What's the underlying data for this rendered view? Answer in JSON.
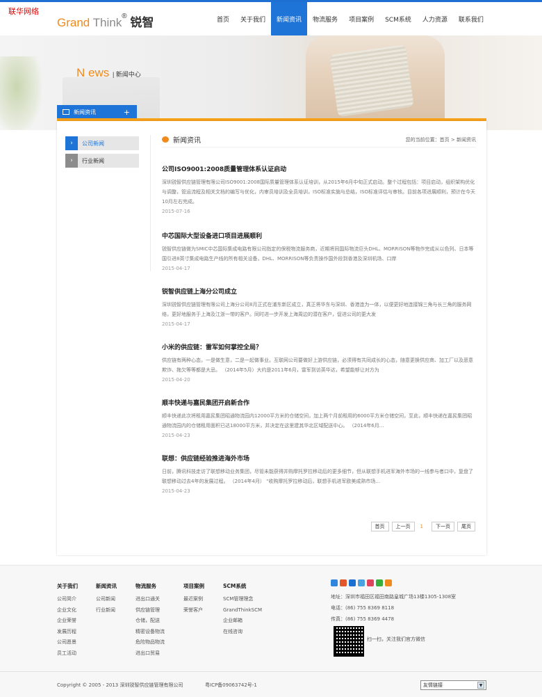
{
  "corner_label": "联华网络",
  "logo": {
    "grand": "Grand",
    "think": " Think",
    "reg": "®",
    "cn": " 锐智"
  },
  "nav": [
    "首页",
    "关于我们",
    "新闻资讯",
    "物流服务",
    "项目案例",
    "SCM系统",
    "人力资源",
    "联系我们"
  ],
  "nav_active": "新闻资讯",
  "banner": {
    "title": "N ews",
    "subtitle": "| 新闻中心",
    "tab_label": "新闻资讯",
    "tab_plus": "+"
  },
  "sidebar": [
    {
      "label": "公司新闻",
      "active": true
    },
    {
      "label": "行业新闻",
      "active": false
    }
  ],
  "section": {
    "title": "新闻资讯",
    "crumb": "您的当前位置：首页  >  新闻资讯"
  },
  "articles": [
    {
      "title": "公司ISO9001:2008质量管理体系认证启动",
      "body": "深圳锐智供应链管理有限公司ISO9001:2008国际质量管理体系认证培训，从2015年6月中旬正式启动。整个过程包括：项目启动，组织架构优化与调整，管运流程及相关文档的编写与优化，内审员培训及全员培训，ISO标准实施与总结，ISO标准评估与审核。目前各项进展顺利，预计在今天10月左右完成。",
      "date": "2015-07-16"
    },
    {
      "title": "中芯国际大型设备进口项目进展顺利",
      "body": "锐智供应链做为SMIC中芯国际集成电路有限公司指定的保税物流服务商，近期将同国际物流巨头DHL、MORRISON等物作完成从以色列、日本等国引进8英寸集成电路生产线的所有相关设备，DHL、MORRISON等负责操作国外段到香港及深圳机场、口岸",
      "date": "2015-04-17"
    },
    {
      "title": "锐智供应链上海分公司成立",
      "body": "深圳锐智供应链管理有限公司上海分公司8月正式在浦东新区成立，真正将华东与深圳、香港连为一体，以便更好地连接锦三角与长三角的服务网络，更好地服务于上海及江浙一带的客户。同时进一步开发上海周边的潜在客户，促进公司的更大发",
      "date": "2015-04-17"
    },
    {
      "title": "小米的供应链：雷军如何掌控全局？",
      "body": "供应链有两种心态，一是做生意，二是一起做事业。互联网公司要做好上游供应链，必须得有共同成长的心态，随意更换供应商、加工厂以及恶意欺诈、拖欠等等都是大忌。 （2014年5月）大约是2011年6月，雷军到访英华达，希望能够让对方为",
      "date": "2015-04-20"
    },
    {
      "title": "顺丰快递与嘉民集团开启新合作",
      "body": "顺丰快递此次将租用嘉民集团昭通物流园内12000平方米的仓储空间，加上两个月前租用的6000平方米仓储空间，至此，顺丰快递在嘉民集团昭通物流园内的仓储租用面积已达18000平方米，并决定在这里建其华北区域配送中心。 （2014年6月...",
      "date": "2015-04-23"
    },
    {
      "title": "联想：供应链经验推进海外市场",
      "body": "日前，腾讯科技走访了联想移动业务集团，尽管未能获得并购摩托罗拉移动后的更多细节，但从联想手机进军海外市场的一线参与者口中，复盘了联想移动过去4年的发展过程。 （2014年4月） \"收购摩托罗拉移动后，联想手机进军欧美成熟市场...",
      "date": "2015-04-23"
    }
  ],
  "pager": {
    "first": "首页",
    "prev": "上一页",
    "current": "1",
    "next": "下一页",
    "last": "尾页"
  },
  "footer": {
    "columns": [
      {
        "title": "关于我们",
        "links": [
          "公司简介",
          "企业文化",
          "企业荣誉",
          "发展历程",
          "公司愿景",
          "员工活动"
        ]
      },
      {
        "title": "新闻资讯",
        "links": [
          "公司新闻",
          "行业新闻"
        ]
      },
      {
        "title": "物流服务",
        "links": [
          "进出口通关",
          "供应链管理",
          "仓储，配送",
          "精密设备物流",
          "危险物品物流",
          "进出口贸易"
        ]
      },
      {
        "title": "项目案例",
        "links": [
          "最近案例",
          "荣誉客户"
        ]
      },
      {
        "title": "SCM系统",
        "links": [
          "SCM管理理念",
          "GrandThinkSCM",
          "企业邮箱",
          "在线咨询"
        ]
      }
    ],
    "address": "地址：深圳市福田区福田南路皇城广场13楼1305-1308室",
    "phone": "电话：(86) 755 8369 8118",
    "fax": "传真：(86) 755 8369 4478",
    "qr_text": "扫一扫，关注我们官方微信",
    "copyright": "Copyright © 2005 - 2013 深圳锐智供应链管理有限公司",
    "icp": "粤ICP备09063742号-1",
    "select_label": "友情链接"
  },
  "colors": {
    "accent_blue": "#1f74d8",
    "accent_orange": "#f08a1d"
  }
}
